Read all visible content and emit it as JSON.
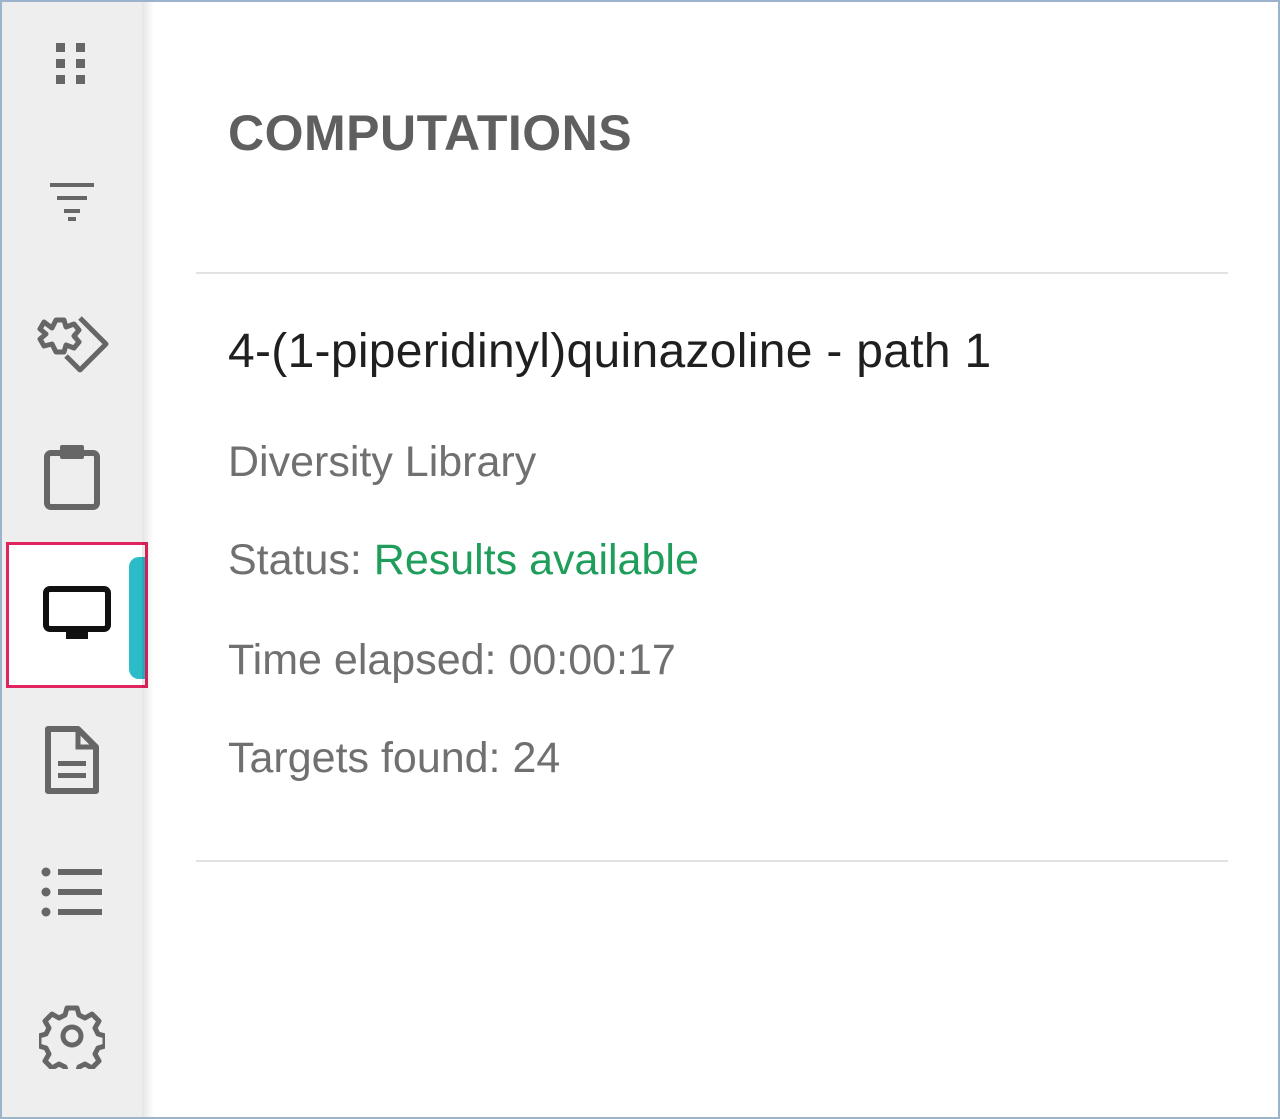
{
  "sidebar": {
    "items": [
      {
        "name": "apps-grid-icon"
      },
      {
        "name": "filter-icon"
      },
      {
        "name": "retrosynthesis-icon"
      },
      {
        "name": "clipboard-icon"
      },
      {
        "name": "monitor-icon",
        "active": true
      },
      {
        "name": "document-icon"
      },
      {
        "name": "list-icon"
      },
      {
        "name": "gear-icon"
      }
    ],
    "accent_color": "#2bbbc9",
    "highlight_border_color": "#e0245e"
  },
  "main": {
    "title": "COMPUTATIONS",
    "computation": {
      "name": "4-(1-piperidinyl)quinazoline - path 1",
      "library": "Diversity Library",
      "status_label": "Status:",
      "status_value": "Results available",
      "status_color": "#1e9e5a",
      "time_label": "Time elapsed:",
      "time_value": "00:00:17",
      "targets_label": "Targets found:",
      "targets_value": "24"
    }
  }
}
